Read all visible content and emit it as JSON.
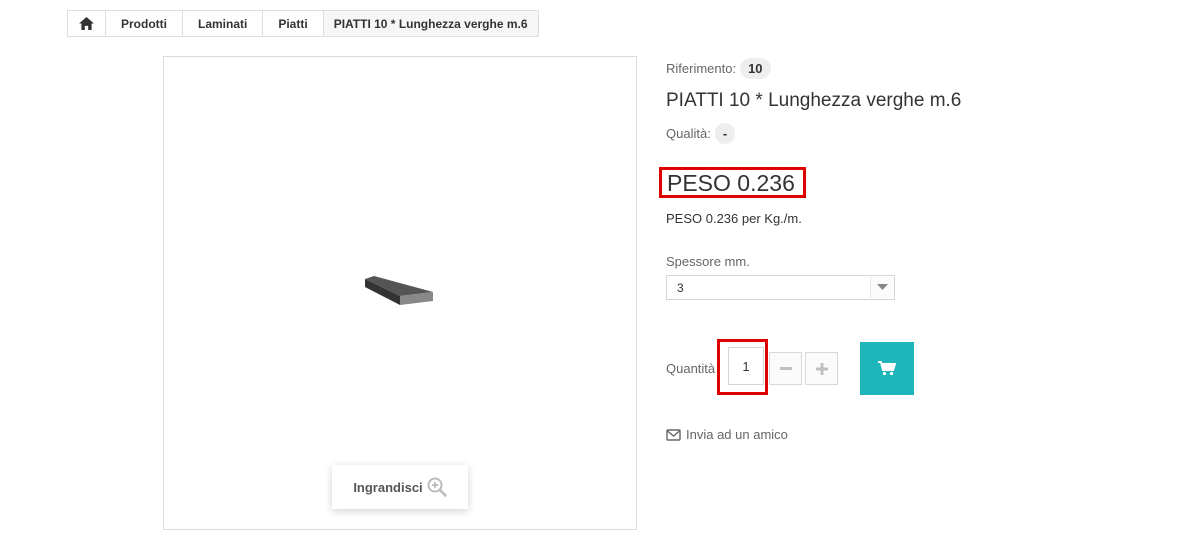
{
  "breadcrumb": {
    "items": [
      "Prodotti",
      "Laminati",
      "Piatti"
    ],
    "current": "PIATTI 10 * Lunghezza verghe m.6"
  },
  "product": {
    "reference_label": "Riferimento:",
    "reference_value": "10",
    "title": "PIATTI 10 * Lunghezza verghe m.6",
    "quality_label": "Qualità:",
    "quality_value": "-",
    "price": "PESO 0.236",
    "price_note": "PESO 0.236 per Kg./m."
  },
  "options": {
    "thickness_label": "Spessore mm.",
    "thickness_selected": "3"
  },
  "quantity": {
    "label": "Quantità",
    "value": "1"
  },
  "actions": {
    "zoom_label": "Ingrandisci",
    "send_friend_label": "Invia ad un amico"
  },
  "colors": {
    "accent": "#1eb6ba",
    "highlight": "#e00000"
  },
  "icons": {
    "home": "home-icon",
    "zoom": "zoom-plus-icon",
    "cart": "cart-icon",
    "envelope": "envelope-icon",
    "minus": "minus-icon",
    "plus": "plus-icon",
    "dropdown": "chevron-down-icon"
  }
}
